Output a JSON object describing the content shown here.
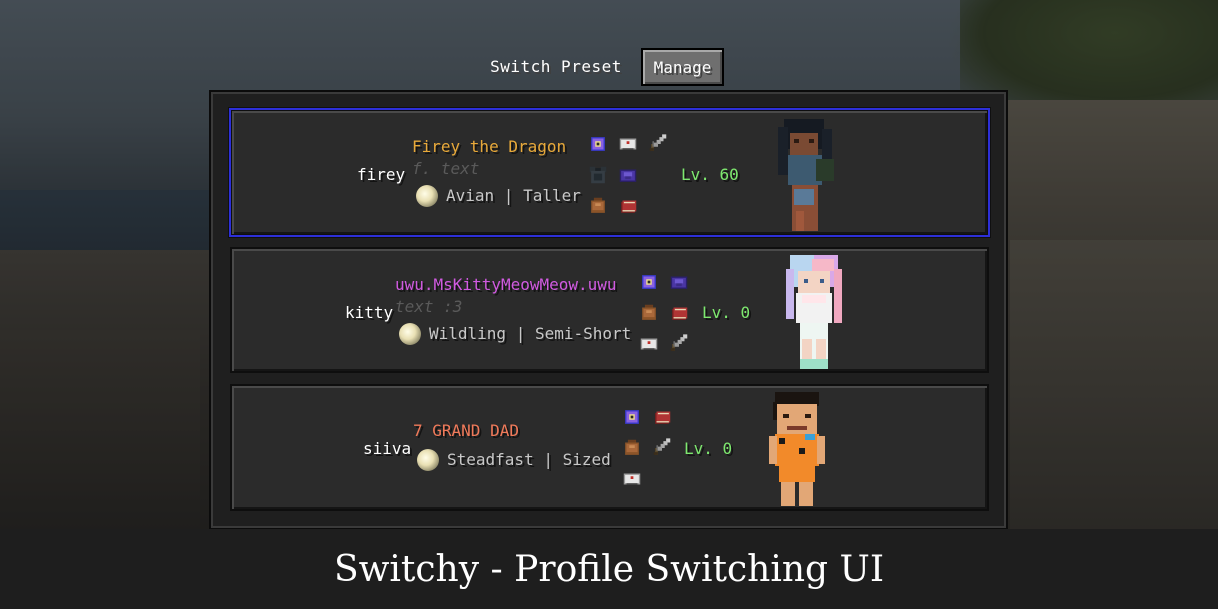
{
  "header": {
    "title": "Switch Preset",
    "manage_label": "Manage"
  },
  "entries": [
    {
      "id": "firey",
      "name": "Firey the Dragon",
      "name_color": "#e8a93a",
      "note": "f. text",
      "origin": "Avian | Taller",
      "level": "Lv. 60",
      "selected": true,
      "icons": [
        "ender-eye-icon",
        "compass-icon",
        "sword-icon",
        "chestplate-icon",
        "cloak-icon",
        "bundle-icon",
        "book-icon"
      ]
    },
    {
      "id": "kitty",
      "name": "uwu.MsKittyMeowMeow.uwu",
      "name_color": "#d05ae0",
      "note": "text :3",
      "origin": "Wildling | Semi-Short",
      "level": "Lv. 0",
      "selected": false,
      "icons": [
        "ender-eye-icon",
        "cloak-icon",
        "bundle-icon",
        "book-icon",
        "compass-icon",
        "sword-icon"
      ]
    },
    {
      "id": "siiva",
      "name": "7 GRAND DAD",
      "name_color": "#f07a5a",
      "note": "",
      "origin": "Steadfast | Sized",
      "level": "Lv. 0",
      "selected": false,
      "icons": [
        "ender-eye-icon",
        "book-icon",
        "bundle-icon",
        "sword-icon",
        "compass-icon"
      ]
    }
  ],
  "caption": "Switchy - Profile Switching UI",
  "colors": {
    "selection": "#2d2fd8",
    "level": "#7ee86f",
    "panel": "#2b2b2b"
  }
}
